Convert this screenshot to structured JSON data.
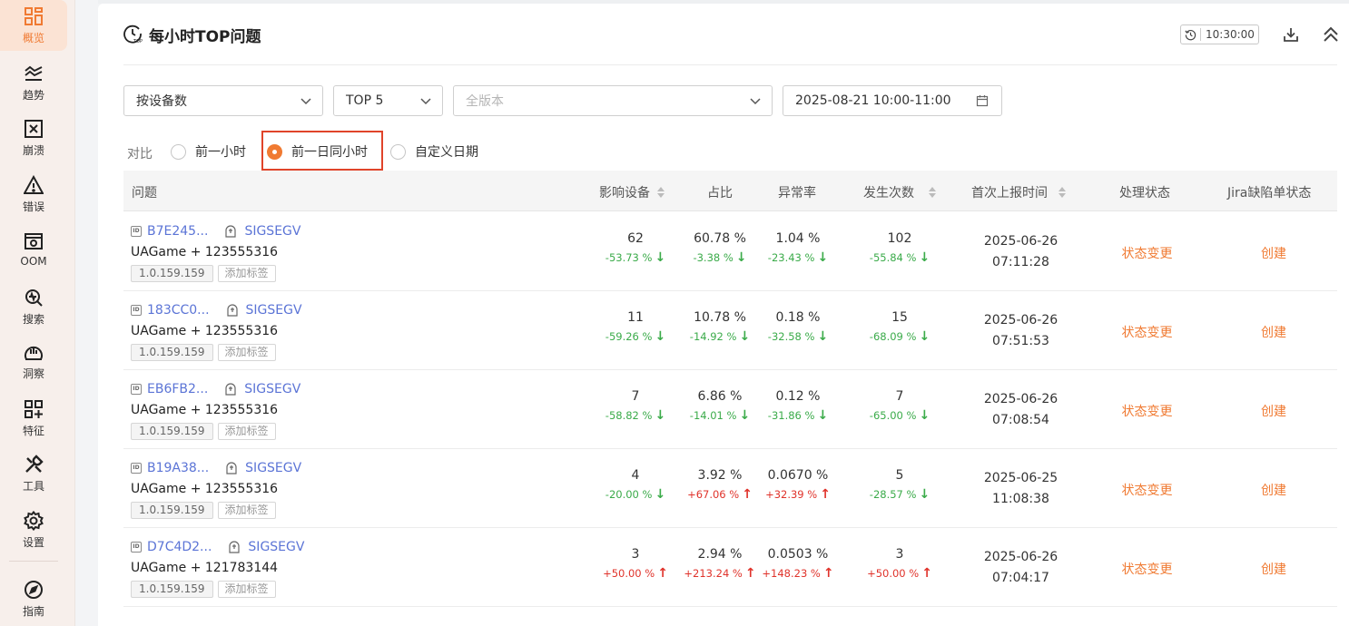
{
  "sidebar": {
    "items": [
      {
        "label": "概览",
        "icon": "overview-icon",
        "active": true
      },
      {
        "label": "趋势",
        "icon": "trend-icon"
      },
      {
        "label": "崩溃",
        "icon": "crash-icon"
      },
      {
        "label": "错误",
        "icon": "error-icon"
      },
      {
        "label": "OOM",
        "icon": "oom-icon"
      },
      {
        "label": "搜索",
        "icon": "search-icon"
      },
      {
        "label": "洞察",
        "icon": "insight-icon"
      },
      {
        "label": "特征",
        "icon": "feature-icon"
      },
      {
        "label": "工具",
        "icon": "tools-icon"
      },
      {
        "label": "设置",
        "icon": "settings-icon"
      },
      {
        "label": "指南",
        "icon": "guide-icon"
      }
    ]
  },
  "header": {
    "title": "每小时TOP问题",
    "time_badge": "10:30:00"
  },
  "filters": {
    "metric": "按设备数",
    "top": "TOP 5",
    "version_placeholder": "全版本",
    "date_range": "2025-08-21 10:00-11:00"
  },
  "compare": {
    "label": "对比",
    "options": [
      "前一小时",
      "前一日同小时",
      "自定义日期"
    ],
    "selected": 1
  },
  "table": {
    "headers": {
      "issue": "问题",
      "devices": "影响设备",
      "ratio": "占比",
      "rate": "异常率",
      "count": "发生次数",
      "first_time": "首次上报时间",
      "status": "处理状态",
      "jira": "Jira缺陷单状态"
    },
    "rows": [
      {
        "id": "B7E245...",
        "signal": "SIGSEGV",
        "app": "UAGame + 123555316",
        "version": "1.0.159.159",
        "add_tag": "添加标签",
        "devices": "62",
        "devices_chg": "-53.73 %",
        "ratio": "60.78 %",
        "ratio_chg": "-3.38 %",
        "rate": "1.04 %",
        "rate_chg": "-23.43 %",
        "count": "102",
        "count_chg": "-55.84 %",
        "date": "2025-06-26",
        "time": "07:11:28",
        "status": "状态变更",
        "jira": "创建"
      },
      {
        "id": "183CC0...",
        "signal": "SIGSEGV",
        "app": "UAGame + 123555316",
        "version": "1.0.159.159",
        "add_tag": "添加标签",
        "devices": "11",
        "devices_chg": "-59.26 %",
        "ratio": "10.78 %",
        "ratio_chg": "-14.92 %",
        "rate": "0.18 %",
        "rate_chg": "-32.58 %",
        "count": "15",
        "count_chg": "-68.09 %",
        "date": "2025-06-26",
        "time": "07:51:53",
        "status": "状态变更",
        "jira": "创建"
      },
      {
        "id": "EB6FB2...",
        "signal": "SIGSEGV",
        "app": "UAGame + 123555316",
        "version": "1.0.159.159",
        "add_tag": "添加标签",
        "devices": "7",
        "devices_chg": "-58.82 %",
        "ratio": "6.86 %",
        "ratio_chg": "-14.01 %",
        "rate": "0.12 %",
        "rate_chg": "-31.86 %",
        "count": "7",
        "count_chg": "-65.00 %",
        "date": "2025-06-26",
        "time": "07:08:54",
        "status": "状态变更",
        "jira": "创建"
      },
      {
        "id": "B19A38...",
        "signal": "SIGSEGV",
        "app": "UAGame + 123555316",
        "version": "1.0.159.159",
        "add_tag": "添加标签",
        "devices": "4",
        "devices_chg": "-20.00 %",
        "ratio": "3.92 %",
        "ratio_chg": "+67.06 %",
        "rate": "0.0670 %",
        "rate_chg": "+32.39 %",
        "count": "5",
        "count_chg": "-28.57 %",
        "date": "2025-06-25",
        "time": "11:08:38",
        "status": "状态变更",
        "jira": "创建"
      },
      {
        "id": "D7C4D2...",
        "signal": "SIGSEGV",
        "app": "UAGame + 121783144",
        "version": "1.0.159.159",
        "add_tag": "添加标签",
        "devices": "3",
        "devices_chg": "+50.00 %",
        "ratio": "2.94 %",
        "ratio_chg": "+213.24 %",
        "rate": "0.0503 %",
        "rate_chg": "+148.23 %",
        "count": "3",
        "count_chg": "+50.00 %",
        "date": "2025-06-26",
        "time": "07:04:17",
        "status": "状态变更",
        "jira": "创建"
      }
    ]
  },
  "colors": {
    "accent": "#f07a32",
    "link": "#5b74d6",
    "down": "#3bab4a",
    "up": "#e0332b",
    "highlight": "#e0442a"
  }
}
